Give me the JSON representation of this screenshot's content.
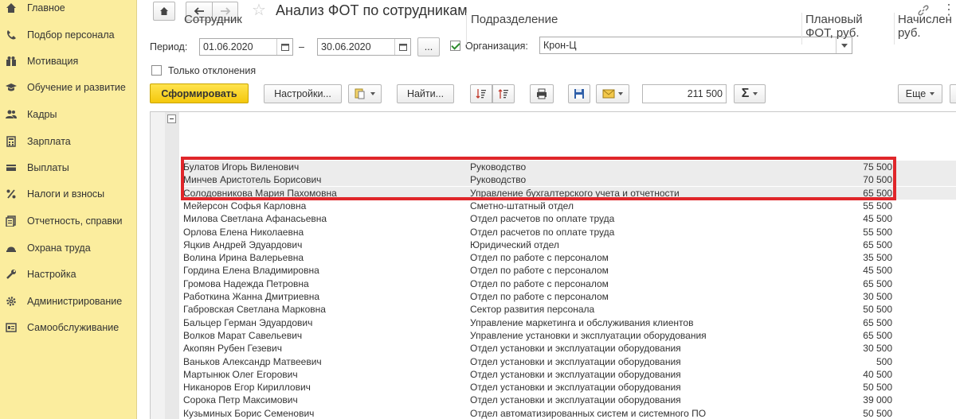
{
  "sidebar": {
    "items": [
      {
        "label": "Главное",
        "icon": "home-icon"
      },
      {
        "label": "Подбор персонала",
        "icon": "phone-icon"
      },
      {
        "label": "Мотивация",
        "icon": "gift-icon"
      },
      {
        "label": "Обучение и развитие",
        "icon": "graduation-cap-icon"
      },
      {
        "label": "Кадры",
        "icon": "people-icon"
      },
      {
        "label": "Зарплата",
        "icon": "calculator-icon"
      },
      {
        "label": "Выплаты",
        "icon": "wallet-icon"
      },
      {
        "label": "Налоги и взносы",
        "icon": "percent-icon"
      },
      {
        "label": "Отчетность, справки",
        "icon": "reports-icon"
      },
      {
        "label": "Охрана труда",
        "icon": "helmet-icon"
      },
      {
        "label": "Настройка",
        "icon": "wrench-icon"
      },
      {
        "label": "Администрирование",
        "icon": "gear-icon"
      },
      {
        "label": "Самообслуживание",
        "icon": "id-card-icon"
      }
    ]
  },
  "header": {
    "title": "Анализ ФОТ по сотрудникам"
  },
  "filters": {
    "period_label": "Период:",
    "date_from": "01.06.2020",
    "dash": "–",
    "date_to": "30.06.2020",
    "more_label": "...",
    "org_label": "Организация:",
    "org_value": "Крон-Ц",
    "org_checked": true,
    "only_deviations_label": "Только отклонения",
    "only_deviations_checked": false
  },
  "toolbar": {
    "generate_label": "Сформировать",
    "settings_label": "Настройки...",
    "find_label": "Найти...",
    "sum_value": "211 500",
    "sigma_label": "Σ",
    "more_label": "Еще"
  },
  "table": {
    "headers": {
      "employee": "Сотрудник",
      "department": "Подразделение",
      "planned_fot_line1": "Плановый",
      "planned_fot_line2": "ФОТ, руб.",
      "accrued_line1": "Начислен",
      "accrued_line2": "руб."
    },
    "rows": [
      {
        "name": "Булатов Игорь Виленович",
        "dept": "Руководство",
        "fot": "75 500"
      },
      {
        "name": "Минчев Аристотель Борисович",
        "dept": "Руководство",
        "fot": "70 500"
      },
      {
        "name": "Солодовникова Мария Пахомовна",
        "dept": "Управление бухгалтерского учета и отчетности",
        "fot": "65 500"
      },
      {
        "name": "Мейерсон Софья Карловна",
        "dept": "Сметно-штатный отдел",
        "fot": "55 500"
      },
      {
        "name": "Милова Светлана Афанасьевна",
        "dept": "Отдел расчетов по оплате труда",
        "fot": "45 500"
      },
      {
        "name": "Орлова Елена Николаевна",
        "dept": "Отдел расчетов по оплате труда",
        "fot": "55 500"
      },
      {
        "name": "Яцкив Андрей Эдуардович",
        "dept": "Юридический отдел",
        "fot": "65 500"
      },
      {
        "name": "Волина Ирина Валерьевна",
        "dept": "Отдел по работе с персоналом",
        "fot": "35 500"
      },
      {
        "name": "Гордина Елена Владимировна",
        "dept": "Отдел по работе с персоналом",
        "fot": "45 500"
      },
      {
        "name": "Громова Надежда Петровна",
        "dept": "Отдел по работе с персоналом",
        "fot": "65 500"
      },
      {
        "name": "Работкина Жанна Дмитриевна",
        "dept": "Отдел по работе с персоналом",
        "fot": "30 500"
      },
      {
        "name": "Габровская Светлана Марковна",
        "dept": "Сектор развития персонала",
        "fot": "50 500"
      },
      {
        "name": "Бальцер Герман Эдуардович",
        "dept": "Управление маркетинга и обслуживания клиентов",
        "fot": "65 500"
      },
      {
        "name": "Волков Марат Савельевич",
        "dept": "Управление установки и эксплуатации оборудования",
        "fot": "65 500"
      },
      {
        "name": "Акопян Рубен Гезевич",
        "dept": "Отдел установки и эксплуатации оборудования",
        "fot": "30 500"
      },
      {
        "name": "Ваньков Александр Матвеевич",
        "dept": "Отдел установки и эксплуатации оборудования",
        "fot": "500"
      },
      {
        "name": "Мартынюк Олег Егорович",
        "dept": "Отдел установки и эксплуатации оборудования",
        "fot": "40 500"
      },
      {
        "name": "Никаноров Егор Кириллович",
        "dept": "Отдел установки и эксплуатации оборудования",
        "fot": "50 500"
      },
      {
        "name": "Сорока Петр Максимович",
        "dept": "Отдел установки и эксплуатации оборудования",
        "fot": "39 000"
      },
      {
        "name": "Кузьминых Борис Семенович",
        "dept": "Отдел автоматизированных систем и системного ПО",
        "fot": "50 500"
      }
    ]
  },
  "colors": {
    "sidebar_bg": "#fbed9e",
    "primary_button": "#f4c80c",
    "highlight": "#e0262a"
  }
}
